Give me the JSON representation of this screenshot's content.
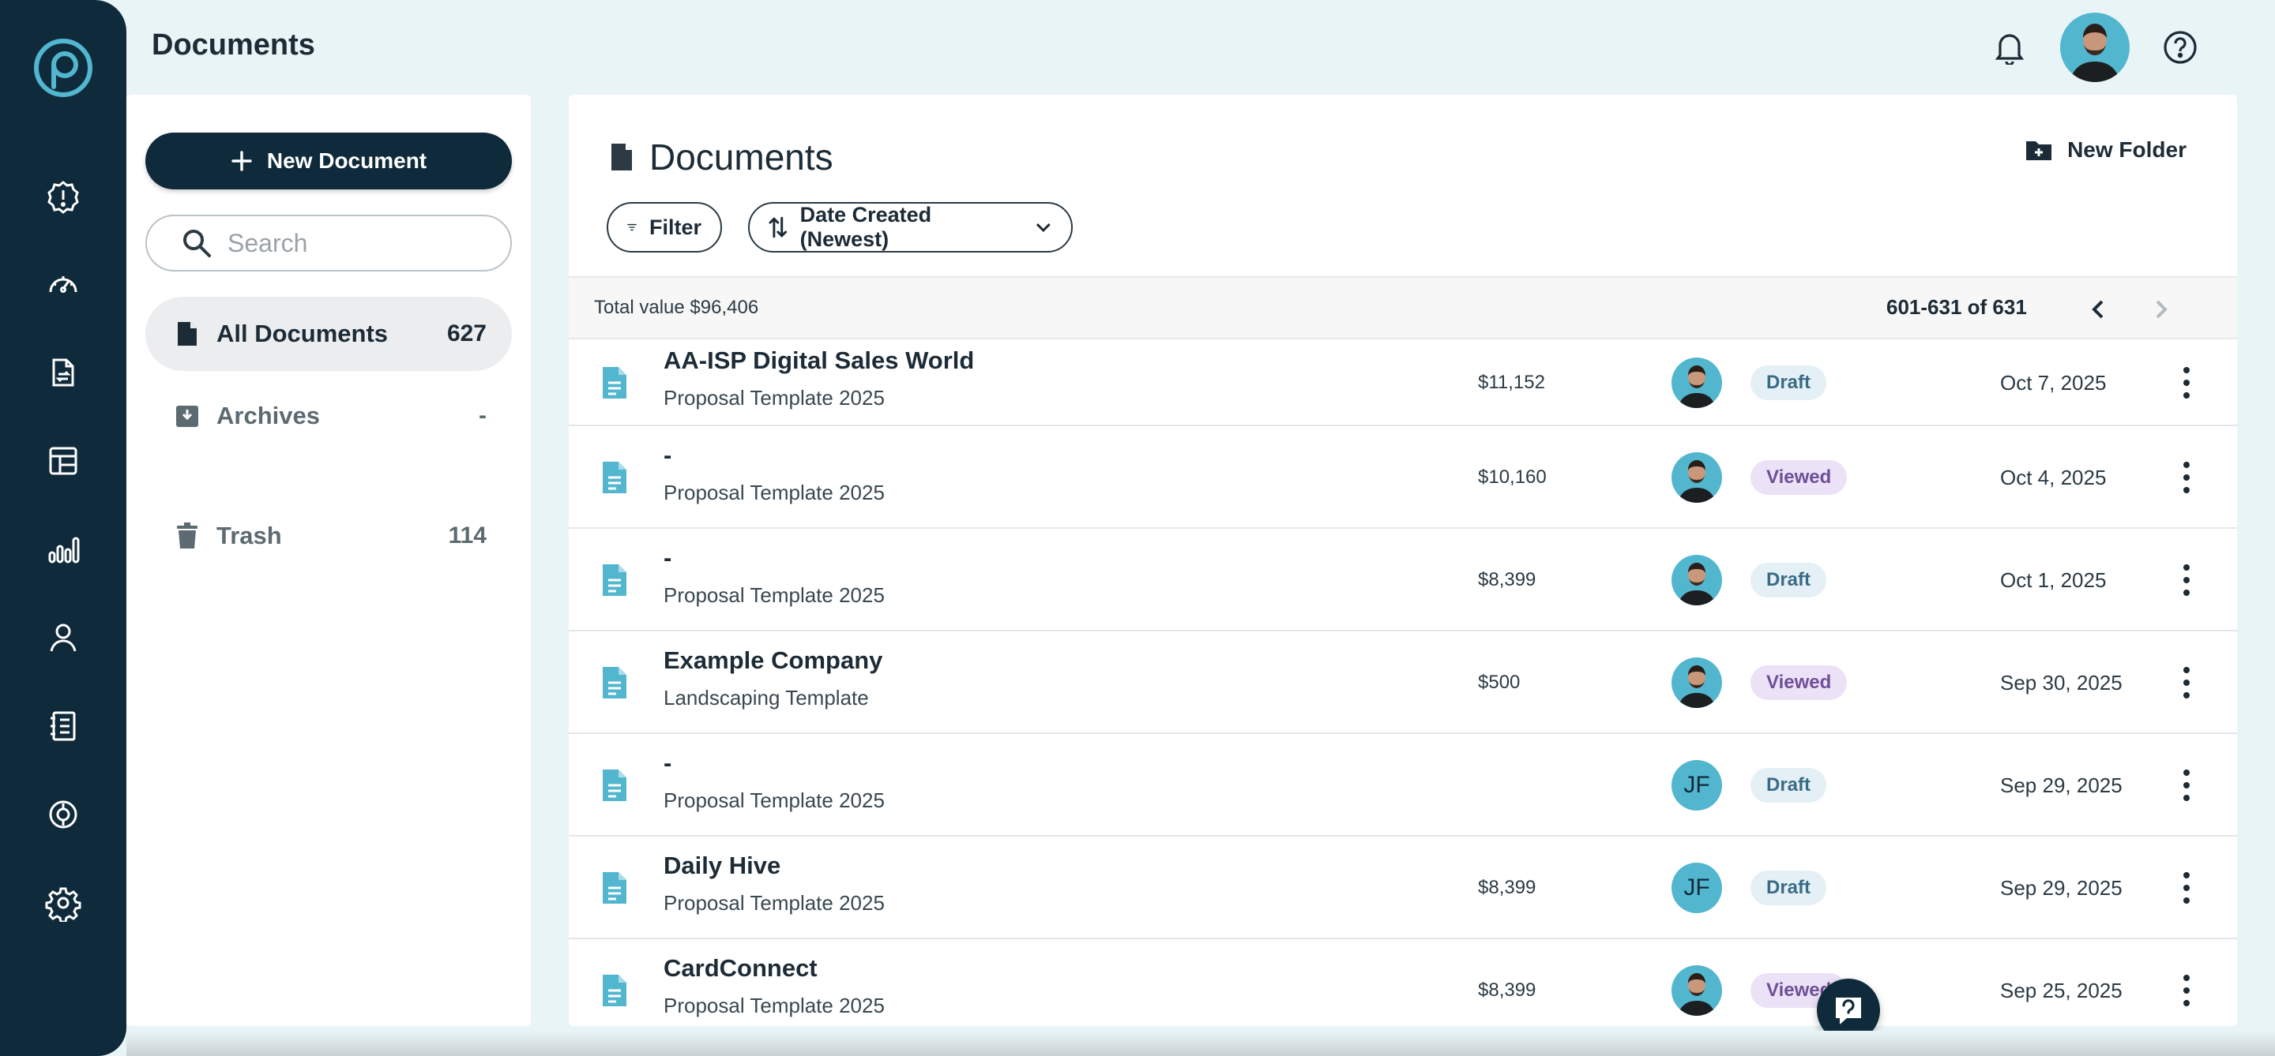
{
  "header": {
    "title": "Documents"
  },
  "icons": {
    "logo": "p-logo-icon",
    "nav": [
      "alert-badge-icon",
      "dashboard-gauge-icon",
      "documents-swap-icon",
      "table-layout-icon",
      "bar-chart-icon",
      "user-icon",
      "catalog-icon",
      "billing-coin-icon",
      "settings-gear-icon"
    ]
  },
  "sidebar": {
    "new_document_label": "New Document",
    "search_placeholder": "Search",
    "folders": [
      {
        "name": "All Documents",
        "count": "627"
      },
      {
        "name": "Archives",
        "count": "-"
      },
      {
        "name": "Trash",
        "count": "114"
      }
    ]
  },
  "main": {
    "title": "Documents",
    "new_folder_label": "New Folder",
    "filter_label": "Filter",
    "sort_label": "Date Created (Newest)",
    "total_value": "Total value $96,406",
    "pagination": "601-631 of 631"
  },
  "documents": [
    {
      "name": "AA-ISP Digital Sales World",
      "template": "Proposal Template 2025",
      "value": "$11,152",
      "owner": "photo",
      "status": "Draft",
      "date": "Oct 7, 2025"
    },
    {
      "name": "-",
      "template": "Proposal Template 2025",
      "value": "$10,160",
      "owner": "photo",
      "status": "Viewed",
      "date": "Oct 4, 2025"
    },
    {
      "name": "-",
      "template": "Proposal Template 2025",
      "value": "$8,399",
      "owner": "photo",
      "status": "Draft",
      "date": "Oct 1, 2025"
    },
    {
      "name": "Example Company",
      "template": "Landscaping Template",
      "value": "$500",
      "owner": "photo",
      "status": "Viewed",
      "date": "Sep 30, 2025"
    },
    {
      "name": "-",
      "template": "Proposal Template 2025",
      "value": "",
      "owner": "JF",
      "status": "Draft",
      "date": "Sep 29, 2025"
    },
    {
      "name": "Daily Hive",
      "template": "Proposal Template 2025",
      "value": "$8,399",
      "owner": "JF",
      "status": "Draft",
      "date": "Sep 29, 2025"
    },
    {
      "name": "CardConnect",
      "template": "Proposal Template 2025",
      "value": "$8,399",
      "owner": "photo",
      "status": "Viewed",
      "date": "Sep 25, 2025"
    }
  ],
  "colors": {
    "rail": "#0f2a3a",
    "accent": "#52b6cf",
    "draft_bg": "#e4f0f6",
    "viewed_bg": "#ece2f7"
  }
}
